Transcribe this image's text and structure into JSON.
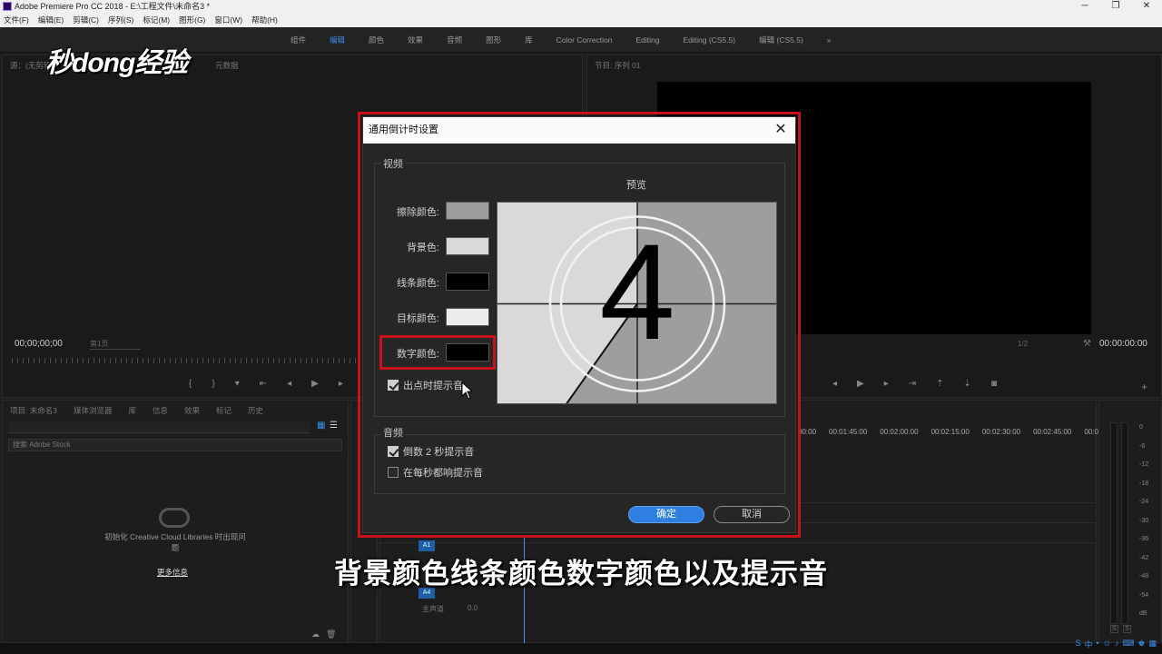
{
  "window": {
    "title": "Adobe Premiere Pro CC 2018 - E:\\工程文件\\未命名3 *",
    "controls": [
      "─",
      "❐",
      "✕"
    ]
  },
  "menu": [
    "文件(F)",
    "编辑(E)",
    "剪辑(C)",
    "序列(S)",
    "标记(M)",
    "图形(G)",
    "窗口(W)",
    "帮助(H)"
  ],
  "workspace_tabs": [
    "组件",
    "编辑",
    "颜色",
    "效果",
    "音频",
    "图形",
    "库",
    "Color Correction",
    "Editing",
    "Editing (CS5.5)",
    "编辑 (CS5.5)",
    "»"
  ],
  "active_workspace": "编辑",
  "watermark": "秒dong经验",
  "source_monitor": {
    "tabs": [
      "源：(无剪辑)",
      "元数据"
    ],
    "timecode": "00;00;00;00",
    "page": "第1页"
  },
  "program_monitor": {
    "tab": "节目: 序列 01",
    "zoom": "1/2",
    "timecode": "00:00:00:00"
  },
  "project_panel": {
    "tabs": [
      "项目: 未命名3",
      "媒体浏览器",
      "库",
      "信息",
      "效果",
      "标记",
      "历史"
    ],
    "search_placeholder": "搜索 Adobe Stock",
    "message": "初始化 Creative Cloud Libraries 时出现问题",
    "link": "更多信息"
  },
  "timeline": {
    "times": [
      "00:00",
      "00:01:45:00",
      "00:02:00:00",
      "00:02:15:00",
      "00:02:30:00",
      "00:02:45:00",
      "00:03:00:0"
    ],
    "tracks": [
      "A1",
      "A4"
    ],
    "master": "主声道",
    "master_value": "0.0"
  },
  "meter": {
    "scale": [
      "0",
      "-6",
      "-12",
      "-18",
      "-24",
      "-30",
      "-36",
      "-42",
      "-48",
      "-54",
      "dB"
    ],
    "solo": [
      "S",
      "S"
    ]
  },
  "dialog": {
    "title": "通用倒计时设置",
    "close": "✕",
    "video_group": "视频",
    "preview_label": "预览",
    "preview_number": "4",
    "colors": [
      {
        "label": "擦除颜色:",
        "color": "#9e9e9e"
      },
      {
        "label": "背景色:",
        "color": "#d9d9d9"
      },
      {
        "label": "线条颜色:",
        "color": "#000000"
      },
      {
        "label": "目标颜色:",
        "color": "#ececec"
      },
      {
        "label": "数字颜色:",
        "color": "#000000"
      }
    ],
    "cue_at_out": {
      "label": "出点时提示音",
      "checked": true
    },
    "audio_group": "音频",
    "cue_2sec": {
      "label": "倒数 2 秒提示音",
      "checked": true
    },
    "cue_every_sec": {
      "label": "在每秒都响提示音",
      "checked": false
    },
    "ok": "确定",
    "cancel": "取消"
  },
  "subtitle": "背景颜色线条颜色数字颜色以及提示音",
  "accent_colors": {
    "highlight": "#c8121b",
    "primary": "#2f7fe0"
  }
}
